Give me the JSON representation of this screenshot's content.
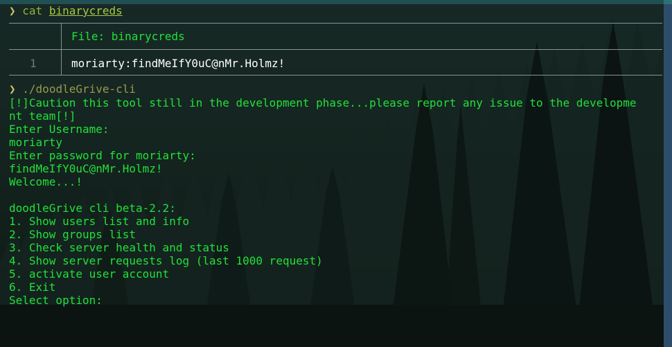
{
  "prompt_symbol": "❯",
  "cat_command": {
    "cmd": "cat",
    "arg": "binarycreds"
  },
  "bat_view": {
    "header": "File: binarycreds",
    "lines": [
      {
        "number": "1",
        "content": "moriarty:findMeIfY0uC@nMr.Holmz!"
      }
    ]
  },
  "run_command": "./doodleGrive-cli",
  "output_lines": [
    "[!]Caution this tool still in the development phase...please report any issue to the developme",
    "nt team[!]",
    "Enter Username:",
    "moriarty",
    "Enter password for moriarty:",
    "findMeIfY0uC@nMr.Holmz!",
    "Welcome...!",
    "",
    "doodleGrive cli beta-2.2:",
    "1. Show users list and info",
    "2. Show groups list",
    "3. Check server health and status",
    "4. Show server requests log (last 1000 request)",
    "5. activate user account",
    "6. Exit",
    "Select option:"
  ],
  "colors": {
    "text_green": "#22e03a",
    "prompt": "#c8c86a",
    "border": "#8a938e"
  }
}
